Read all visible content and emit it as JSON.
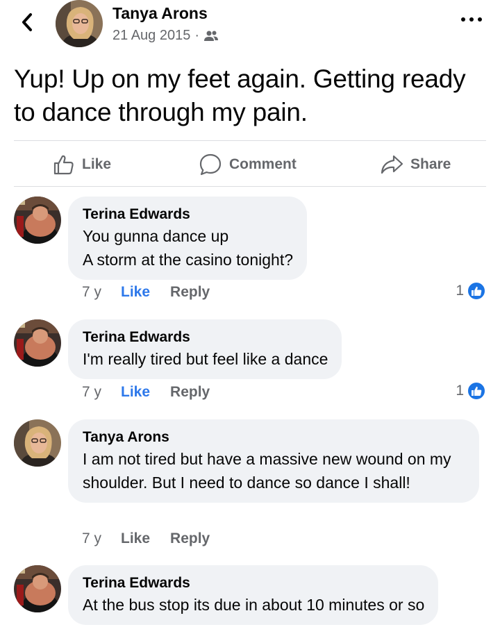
{
  "post": {
    "author": "Tanya Arons",
    "date": "21 Aug 2015",
    "meta_separator": "·",
    "audience_icon": "friends-icon",
    "text": "Yup!  Up on my feet again.  Getting ready to dance through my pain."
  },
  "actions": {
    "like": "Like",
    "comment": "Comment",
    "share": "Share"
  },
  "comments": [
    {
      "author": "Terina Edwards",
      "text": "You gunna dance up\nA storm at the casino tonight?",
      "time": "7 y",
      "like_label": "Like",
      "reply_label": "Reply",
      "liked": true,
      "reaction_count": "1"
    },
    {
      "author": "Terina Edwards",
      "text": "I'm really tired but feel like a dance",
      "time": "7 y",
      "like_label": "Like",
      "reply_label": "Reply",
      "liked": true,
      "reaction_count": "1"
    },
    {
      "author": "Tanya Arons",
      "text": "I am not tired but have a massive new wound on my shoulder.  But I need to dance so dance I shall!",
      "time": "7 y",
      "like_label": "Like",
      "reply_label": "Reply",
      "liked": false
    },
    {
      "author": "Terina Edwards",
      "text": "At the bus stop its due in about 10 minutes or so"
    }
  ],
  "colors": {
    "accent": "#2d78ea",
    "secondary_text": "#65676b",
    "bubble": "#f0f2f5",
    "like_badge": "#1b74e4"
  }
}
